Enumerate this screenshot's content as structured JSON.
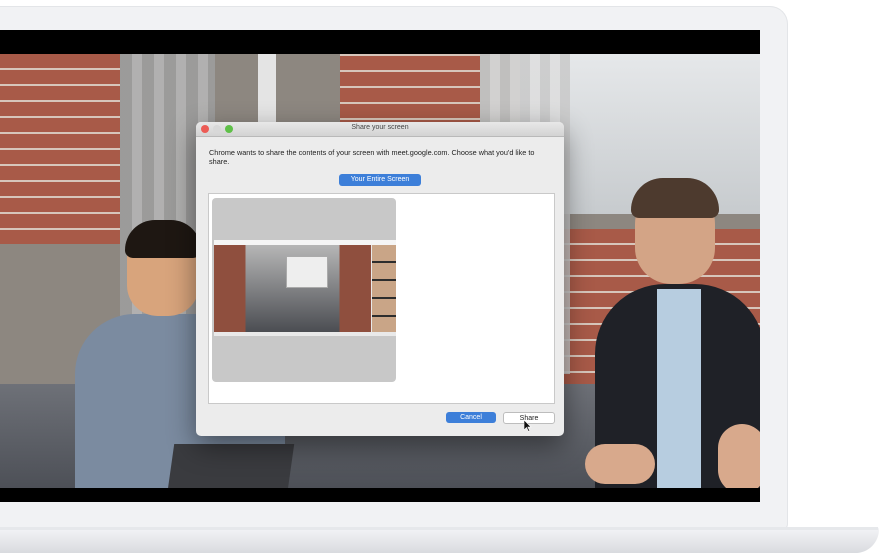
{
  "dialog": {
    "title": "Share your screen",
    "message": "Chrome wants to share the contents of your screen with meet.google.com. Choose what you'd like to share.",
    "tab_label": "Your Entire Screen",
    "cancel_label": "Cancel",
    "share_label": "Share"
  },
  "colors": {
    "accent": "#3d7fd9",
    "close_button": "#ec5b55",
    "maximize_button": "#5fc048"
  }
}
